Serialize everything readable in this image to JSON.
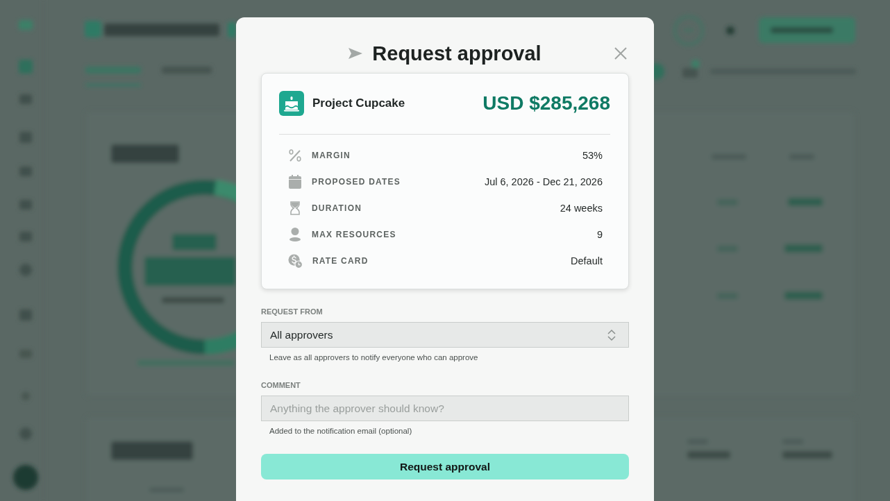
{
  "dialog": {
    "title": "Request approval",
    "summary": {
      "project_name": "Project Cupcake",
      "total": "USD $285,268",
      "details": [
        {
          "kind": "percent",
          "label": "MARGIN",
          "value": "53%"
        },
        {
          "kind": "calendar",
          "label": "PROPOSED DATES",
          "value": "Jul 6, 2026 - Dec 21, 2026"
        },
        {
          "kind": "hourglass",
          "label": "DURATION",
          "value": "24 weeks"
        },
        {
          "kind": "person",
          "label": "MAX RESOURCES",
          "value": "9"
        },
        {
          "kind": "rate",
          "label": "RATE CARD",
          "value": "Default"
        }
      ]
    },
    "request_from": {
      "label": "REQUEST FROM",
      "value": "All approvers",
      "hint": "Leave as all approvers to notify everyone who can approve"
    },
    "comment": {
      "label": "COMMENT",
      "placeholder": "Anything the approver should know?",
      "hint": "Added to the notification email (optional)"
    },
    "submit_button": "Request approval"
  }
}
